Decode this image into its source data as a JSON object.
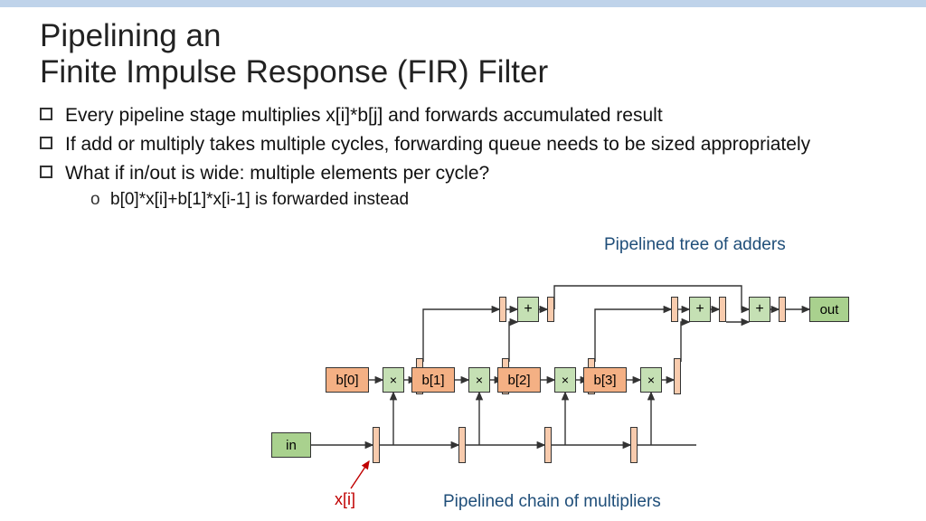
{
  "title_line1": "Pipelining an",
  "title_line2": "Finite Impulse Response (FIR) Filter",
  "bullets": {
    "b1": "Every pipeline stage multiplies x[i]*b[j] and forwards accumulated result",
    "b2": "If add or multiply takes multiple cycles, forwarding queue needs to be sized appropriately",
    "b3": "What if in/out is wide: multiple elements per cycle?",
    "b3_sub": "b[0]*x[i]+b[1]*x[i-1] is forwarded instead"
  },
  "annot": {
    "adders": "Pipelined tree of adders",
    "mults": "Pipelined chain of multipliers",
    "xi": "x[i]"
  },
  "diagram": {
    "in": "in",
    "out": "out",
    "coef": [
      "b[0]",
      "b[1]",
      "b[2]",
      "b[3]"
    ],
    "mul_sym": "×",
    "add_sym": "+"
  }
}
